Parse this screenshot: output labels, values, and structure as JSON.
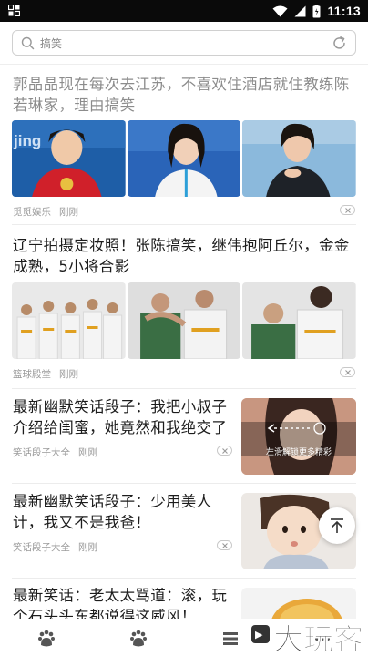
{
  "status_bar": {
    "time": "11:13"
  },
  "search": {
    "placeholder": "搞笑"
  },
  "feed": [
    {
      "title": "郭晶晶现在每次去江苏，不喜欢住酒店就住教练陈若琳家，理由搞笑",
      "source": "觅觅娱乐",
      "time": "刚刚"
    },
    {
      "title": "辽宁拍摄定妆照！张陈搞笑，继伟抱阿丘尔，金金成熟，5小将合影",
      "source": "篮球殿堂",
      "time": "刚刚"
    },
    {
      "title": "最新幽默笑话段子：我把小叔子介绍给闺蜜，她竟然和我绝交了",
      "source": "笑话段子大全",
      "time": "刚刚",
      "thumb_caption": "左滑解锁更多精彩"
    },
    {
      "title": "最新幽默笑话段子：少用美人计，我又不是我爸！",
      "source": "笑话段子大全",
      "time": "刚刚"
    },
    {
      "title": "最新笑话：老太太骂道：滚，玩个石头头东都说得这威风！"
    }
  ],
  "tabs": [
    "paw-icon",
    "paw-icon",
    "list-icon",
    "more-icon"
  ],
  "watermark": "大玩客"
}
